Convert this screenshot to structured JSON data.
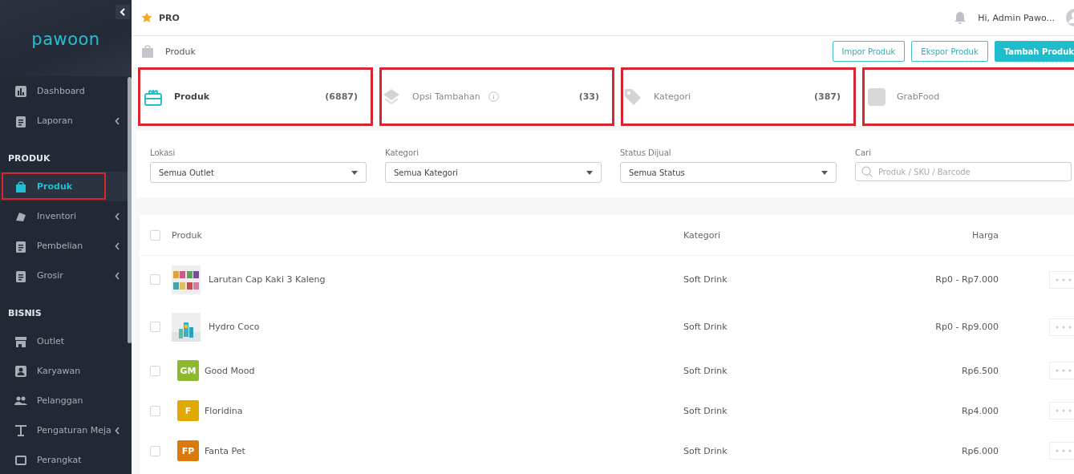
{
  "sidebar": {
    "logo": "pawoon",
    "sections": [
      {
        "items": [
          {
            "label": "Dashboard",
            "selected": false,
            "has_submenu": false,
            "highlighted": false
          },
          {
            "label": "Laporan",
            "selected": false,
            "has_submenu": true,
            "highlighted": false
          }
        ]
      },
      {
        "title": "PRODUK",
        "items": [
          {
            "label": "Produk",
            "selected": true,
            "has_submenu": false,
            "highlighted": true
          },
          {
            "label": "Inventori",
            "selected": false,
            "has_submenu": true,
            "highlighted": false
          },
          {
            "label": "Pembelian",
            "selected": false,
            "has_submenu": true,
            "highlighted": false
          },
          {
            "label": "Grosir",
            "selected": false,
            "has_submenu": true,
            "highlighted": false
          }
        ]
      },
      {
        "title": "BISNIS",
        "items": [
          {
            "label": "Outlet",
            "selected": false,
            "has_submenu": false,
            "highlighted": false
          },
          {
            "label": "Karyawan",
            "selected": false,
            "has_submenu": false,
            "highlighted": false
          },
          {
            "label": "Pelanggan",
            "selected": false,
            "has_submenu": false,
            "highlighted": false
          },
          {
            "label": "Pengaturan Meja",
            "selected": false,
            "has_submenu": true,
            "highlighted": false
          },
          {
            "label": "Perangkat",
            "selected": false,
            "has_submenu": false,
            "highlighted": false
          }
        ]
      }
    ]
  },
  "topbar": {
    "plan": "PRO",
    "greeting": "Hi, Admin Pawo..."
  },
  "page": {
    "title": "Produk",
    "buttons": [
      {
        "label": "Impor Produk",
        "kind": "outline"
      },
      {
        "label": "Ekspor Produk",
        "kind": "outline"
      },
      {
        "label": "Tambah Produk",
        "kind": "primary"
      }
    ]
  },
  "tabs": [
    {
      "label": "Produk",
      "count": "(6887)",
      "selected": true,
      "highlighted": true,
      "info": false
    },
    {
      "label": "Opsi Tambahan",
      "count": "(33)",
      "selected": false,
      "highlighted": true,
      "info": true
    },
    {
      "label": "Kategori",
      "count": "(387)",
      "selected": false,
      "highlighted": true,
      "info": false
    },
    {
      "label": "GrabFood",
      "selected": false,
      "highlighted": true,
      "info": false
    }
  ],
  "filters": [
    {
      "label": "Lokasi",
      "value": "Semua Outlet",
      "kind": "select"
    },
    {
      "label": "Kategori",
      "value": "Semua Kategori",
      "kind": "select"
    },
    {
      "label": "Status Dijual",
      "value": "Semua Status",
      "kind": "select"
    },
    {
      "label": "Cari",
      "placeholder": "Produk / SKU / Barcode",
      "kind": "search"
    }
  ],
  "table": {
    "columns": [
      "Produk",
      "Kategori",
      "Harga"
    ],
    "select_all_checked": false,
    "rows": [
      {
        "name": "Larutan Cap Kaki 3 Kaleng",
        "category": "Soft Drink",
        "price": "Rp0 - Rp7.000",
        "checked": false
      },
      {
        "name": "Hydro Coco",
        "category": "Soft Drink",
        "price": "Rp0 - Rp9.000",
        "checked": false
      },
      {
        "name": "Good Mood",
        "category": "Soft Drink",
        "price": "Rp6.500",
        "thumb": {
          "kind": "initials",
          "text": "GM",
          "color": "#8cba2e"
        },
        "checked": false
      },
      {
        "name": "Floridina",
        "category": "Soft Drink",
        "price": "Rp4.000",
        "thumb": {
          "kind": "initials",
          "text": "F",
          "color": "#e0a800"
        },
        "checked": false
      },
      {
        "name": "Fanta Pet",
        "category": "Soft Drink",
        "price": "Rp6.000",
        "thumb": {
          "kind": "initials",
          "text": "FP",
          "color": "#db7a0c"
        },
        "checked": false
      }
    ]
  }
}
